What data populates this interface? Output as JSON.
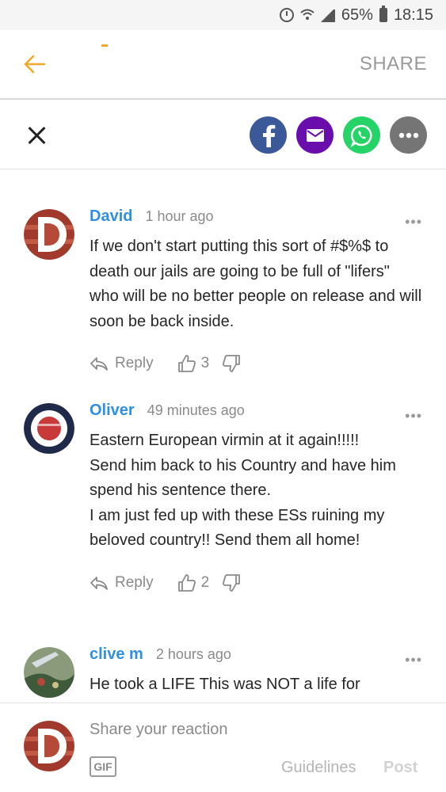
{
  "status_bar": {
    "battery_percent": "65%",
    "time": "18:15",
    "icons": [
      "alarm-icon",
      "wifi-icon",
      "signal-icon",
      "battery-icon"
    ]
  },
  "header": {
    "share_label": "SHARE",
    "accent_color": "#f0a82a"
  },
  "share_buttons": [
    {
      "name": "facebook",
      "color": "#3b5998"
    },
    {
      "name": "email",
      "color": "#6a0dad"
    },
    {
      "name": "whatsapp",
      "color": "#25d366"
    },
    {
      "name": "more",
      "color": "#757575"
    }
  ],
  "comments": [
    {
      "author": "David",
      "time": "1 hour ago",
      "text": "If we don't start putting this sort of #$%$ to death our jails are going to be full of \"lifers\" who will be no better people on release and will soon be back inside.",
      "reply_label": "Reply",
      "likes": "3"
    },
    {
      "author": "Oliver",
      "time": "49 minutes ago",
      "text": "Eastern European virmin at it again!!!!!\nSend him back to his Country and have him spend his sentence there.\nI am just fed up with these ESs ruining my beloved country!! Send them all home!",
      "reply_label": "Reply",
      "likes": "2"
    },
    {
      "author": "clive m",
      "time": "2 hours ago",
      "text": "He took a LIFE This was NOT a life for"
    }
  ],
  "composer": {
    "placeholder": "Share your reaction",
    "gif_label": "GIF",
    "guidelines_label": "Guidelines",
    "post_label": "Post"
  }
}
